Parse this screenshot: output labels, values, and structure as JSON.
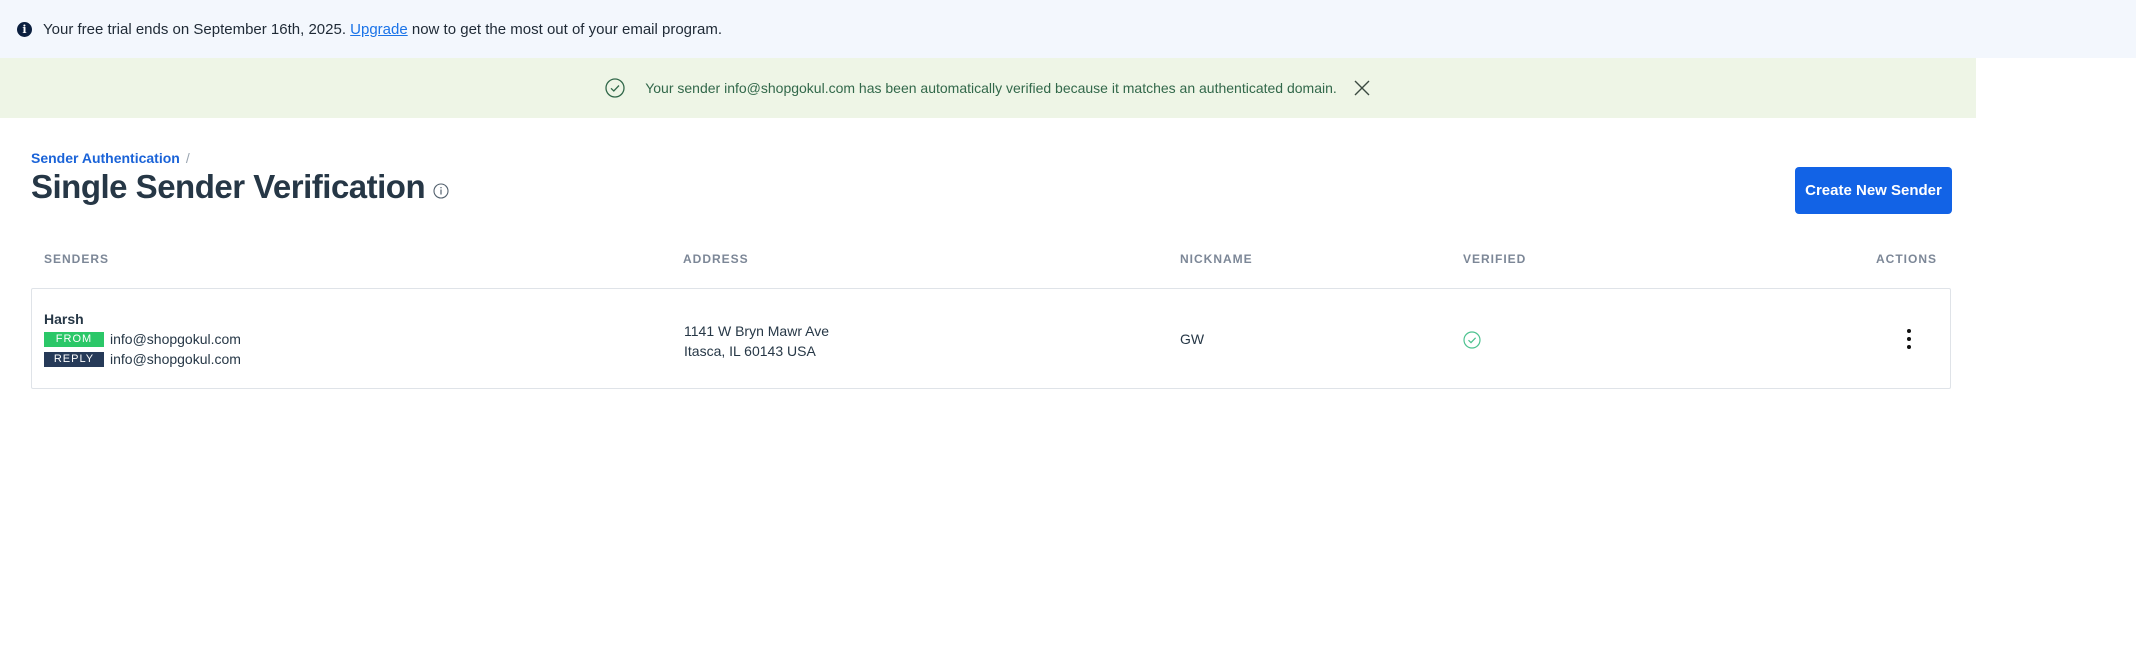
{
  "trial_banner": {
    "text_before": "Your free trial ends on September 16th, 2025.",
    "link_label": "Upgrade",
    "text_after": "now to get the most out of your email program."
  },
  "success_banner": {
    "message": "Your sender info@shopgokul.com has been automatically verified because it matches an authenticated domain."
  },
  "breadcrumb": {
    "parent": "Sender Authentication",
    "separator": "/"
  },
  "page": {
    "title": "Single Sender Verification",
    "create_button": "Create New Sender"
  },
  "table": {
    "headers": {
      "senders": "SENDERS",
      "address": "ADDRESS",
      "nickname": "NICKNAME",
      "verified": "VERIFIED",
      "actions": "ACTIONS"
    },
    "rows": [
      {
        "name": "Harsh",
        "from_tag": "FROM",
        "from_email": "info@shopgokul.com",
        "reply_tag": "REPLY",
        "reply_email": "info@shopgokul.com",
        "address_line1": "1141 W Bryn Mawr Ave",
        "address_line2": "Itasca, IL 60143 USA",
        "nickname": "GW",
        "verified": true
      }
    ]
  },
  "colors": {
    "primary": "#1263e6",
    "success_banner_bg": "#eef5e6",
    "trial_bar_bg": "#f3f7fd",
    "from_tag": "#2bc768",
    "reply_tag": "#263a58"
  }
}
